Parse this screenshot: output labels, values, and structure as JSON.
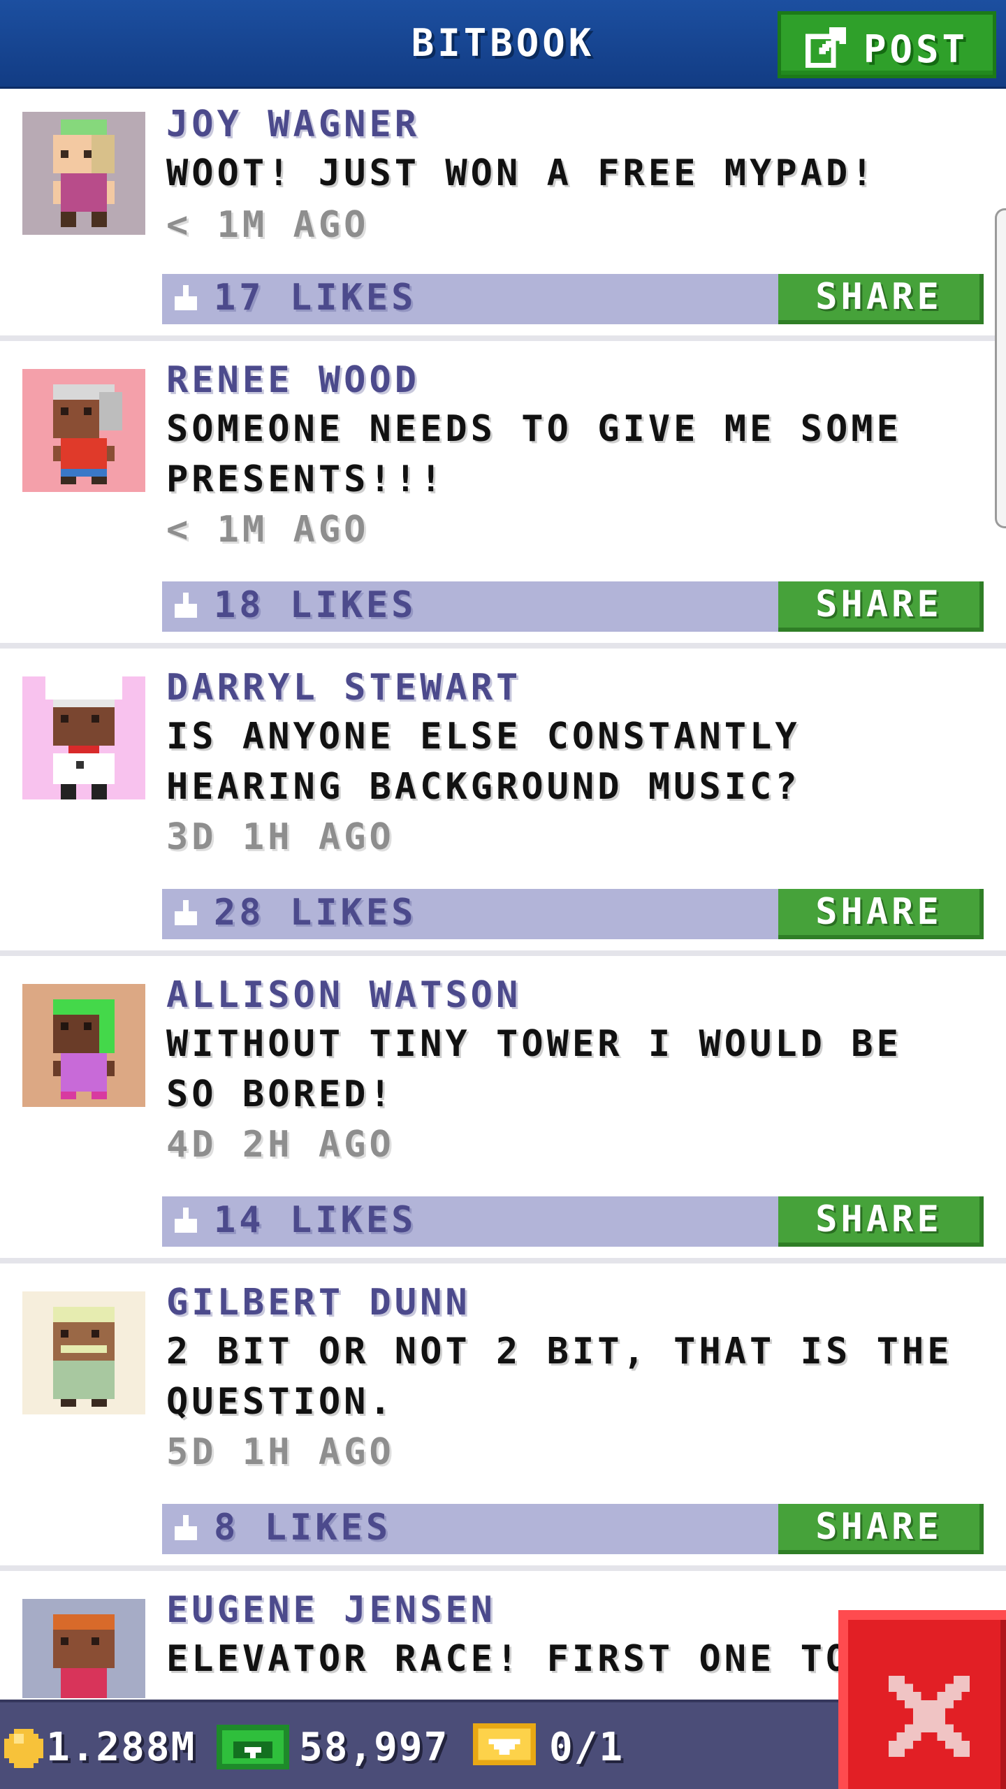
{
  "header": {
    "title": "BITBOOK",
    "post_label": "POST"
  },
  "posts": [
    {
      "author": "JOY WAGNER",
      "message": "WOOT! JUST WON A FREE MYPAD!",
      "time": "< 1M AGO",
      "likes": "17 LIKES",
      "share_label": "SHARE",
      "avatar_bg": "#b8aab4"
    },
    {
      "author": "RENEE WOOD",
      "message": "SOMEONE NEEDS TO GIVE ME SOME PRESENTS!!!",
      "time": "< 1M AGO",
      "likes": "18 LIKES",
      "share_label": "SHARE",
      "avatar_bg": "#f4a0aa"
    },
    {
      "author": "DARRYL STEWART",
      "message": "IS ANYONE ELSE CONSTANTLY HEARING BACKGROUND MUSIC?",
      "time": "3D 1H AGO",
      "likes": "28 LIKES",
      "share_label": "SHARE",
      "avatar_bg": "#f8c2ee"
    },
    {
      "author": "ALLISON WATSON",
      "message": "WITHOUT TINY TOWER I WOULD BE SO BORED!",
      "time": "4D 2H AGO",
      "likes": "14 LIKES",
      "share_label": "SHARE",
      "avatar_bg": "#dca884"
    },
    {
      "author": "GILBERT DUNN",
      "message": "2 BIT OR NOT 2 BIT, THAT IS THE QUESTION.",
      "time": "5D 1H AGO",
      "likes": "8 LIKES",
      "share_label": "SHARE",
      "avatar_bg": "#f6eedc"
    },
    {
      "author": "EUGENE JENSEN",
      "message": "ELEVATOR RACE! FIRST ONE TO T",
      "avatar_bg": "#a6acc6"
    }
  ],
  "status": {
    "coins": "1.288M",
    "bux": "58,997",
    "tickets": "0/1"
  },
  "colors": {
    "header_blue": "#1c4fa0",
    "post_green": "#2fa02a",
    "share_green": "#46a23a",
    "like_bar": "#b2b4d8",
    "author_purple": "#4c4a8c",
    "close_red": "#e21f25",
    "status_bar": "#4b4d78"
  },
  "icons": {
    "post": "edit-icon",
    "like": "thumbs-up-icon",
    "close": "close-icon",
    "coin": "coin-icon",
    "bux": "bux-icon",
    "ticket": "ticket-icon"
  }
}
